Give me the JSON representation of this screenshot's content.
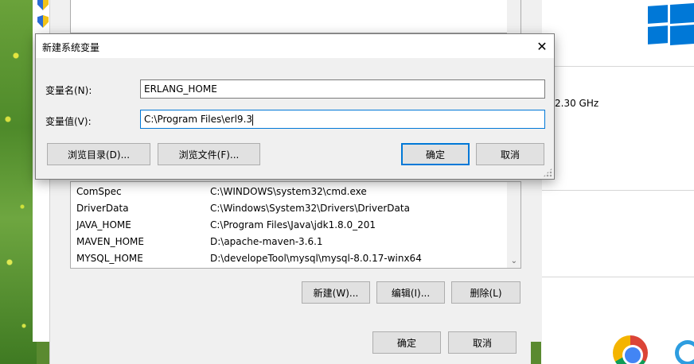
{
  "dialog": {
    "title": "新建系统变量",
    "name_label": "变量名(N):",
    "name_value": "ERLANG_HOME",
    "value_label": "变量值(V):",
    "value_value": "C:\\Program Files\\erl9.3",
    "browse_dir_label": "浏览目录(D)...",
    "browse_file_label": "浏览文件(F)...",
    "ok_label": "确定",
    "cancel_label": "取消"
  },
  "system_vars": {
    "rows": [
      {
        "name": "ComSpec",
        "value": "C:\\WINDOWS\\system32\\cmd.exe"
      },
      {
        "name": "DriverData",
        "value": "C:\\Windows\\System32\\Drivers\\DriverData"
      },
      {
        "name": "JAVA_HOME",
        "value": "C:\\Program Files\\Java\\jdk1.8.0_201"
      },
      {
        "name": "MAVEN_HOME",
        "value": "D:\\apache-maven-3.6.1"
      },
      {
        "name": "MYSQL_HOME",
        "value": "D:\\developeTool\\mysql\\mysql-8.0.17-winx64"
      }
    ],
    "new_label": "新建(W)...",
    "edit_label": "编辑(I)...",
    "delete_label": "删除(L)"
  },
  "parent_buttons": {
    "ok_label": "确定",
    "cancel_label": "取消"
  },
  "settings": {
    "cpu_text": "2.30 GHz"
  },
  "colors": {
    "accent": "#0078d7",
    "windows_blue": "#0078d7",
    "dialog_bg": "#f0f0f0"
  }
}
